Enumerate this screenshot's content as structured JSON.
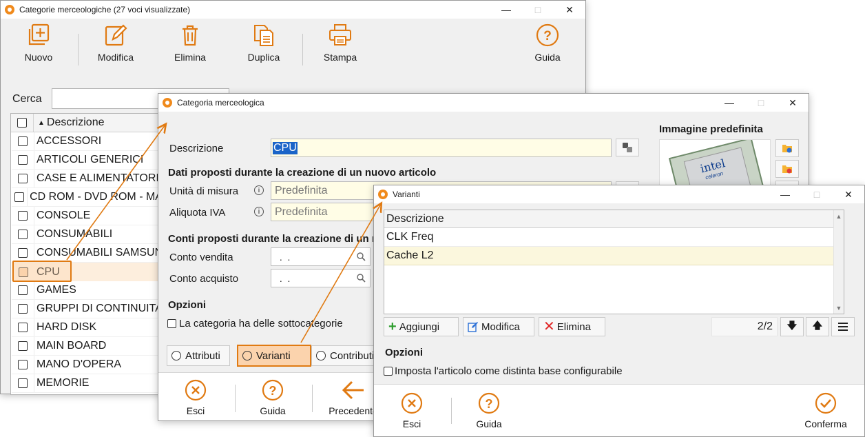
{
  "win1": {
    "title": "Categorie merceologiche (27 voci visualizzate)",
    "toolbar": {
      "nuovo": "Nuovo",
      "modifica": "Modifica",
      "elimina": "Elimina",
      "duplica": "Duplica",
      "stampa": "Stampa",
      "guida": "Guida"
    },
    "search_label": "Cerca",
    "column_header": "Descrizione",
    "rows": [
      "ACCESSORI",
      "ARTICOLI GENERICI",
      "CASE E ALIMENTATORI",
      "CD ROM - DVD ROM - MASTERIZZATORI",
      "CONSOLE",
      "CONSUMABILI",
      "CONSUMABILI SAMSUNG",
      "CPU",
      "GAMES",
      "GRUPPI DI CONTINUITA'",
      "HARD DISK",
      "MAIN BOARD",
      "MANO D'OPERA",
      "MEMORIE"
    ]
  },
  "win2": {
    "title": "Categoria merceologica",
    "descrizione_label": "Descrizione",
    "descrizione_value": "CPU",
    "section_dati": "Dati proposti durante la creazione di un nuovo articolo",
    "unita_label": "Unità di misura",
    "unita_value": "Predefinita",
    "aliquota_label": "Aliquota IVA",
    "aliquota_value": "Predefinita",
    "section_conti": "Conti proposti durante la creazione di un nuovo articolo",
    "conto_vendita_label": "Conto vendita",
    "conto_vendita_value": " .  .",
    "conto_acquisto_label": "Conto acquisto",
    "conto_acquisto_value": " .  .",
    "opzioni_label": "Opzioni",
    "sottocategorie_label": "La categoria ha delle sottocategorie",
    "tab_attributi": "Attributi",
    "tab_varianti": "Varianti",
    "tab_contributi": "Contributi",
    "immagine_label": "Immagine predefinita",
    "logo_text": "intel",
    "logo_sub": "celeron",
    "footer": {
      "esci": "Esci",
      "guida": "Guida",
      "precedente": "Precedente"
    }
  },
  "win3": {
    "title": "Varianti",
    "column_header": "Descrizione",
    "rows": [
      "CLK Freq",
      "Cache L2"
    ],
    "aggiungi": "Aggiungi",
    "modifica": "Modifica",
    "elimina": "Elimina",
    "pager": "2/2",
    "opzioni_label": "Opzioni",
    "distinta_label": "Imposta l'articolo come distinta base configurabile",
    "footer": {
      "esci": "Esci",
      "guida": "Guida",
      "conferma": "Conferma"
    }
  },
  "colors": {
    "accent": "#e07a12",
    "highlight": "#fde9d6",
    "field_bg": "#fffde6",
    "selection": "#1a64c8"
  }
}
